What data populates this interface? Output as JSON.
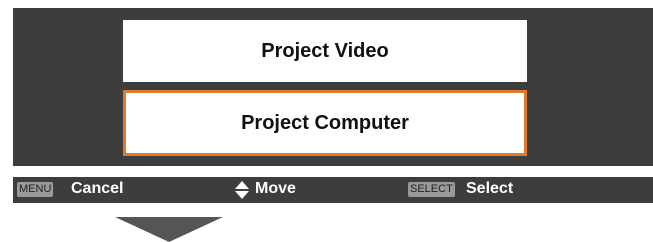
{
  "menu": {
    "options": [
      {
        "label": "Project Video",
        "selected": false
      },
      {
        "label": "Project Computer",
        "selected": true
      }
    ],
    "highlight_color": "#e07a2c"
  },
  "status_bar": {
    "cancel_key": "MENU",
    "cancel_label": "Cancel",
    "move_icon": "up-down-triangle-icon",
    "move_label": "Move",
    "select_key": "SELECT",
    "select_label": "Select"
  },
  "flow_arrow_icon": "down-arrow-icon"
}
